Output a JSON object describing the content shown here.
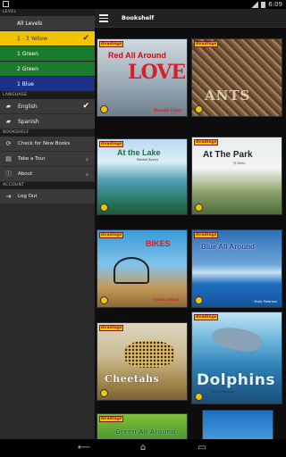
{
  "status_bar": {
    "time": "6:09"
  },
  "drawer": {
    "level_header": "LEVEL",
    "levels": [
      {
        "label": "All Levels",
        "color": "#3a3a3a"
      },
      {
        "label": "1 - 3 Yellow",
        "color": "#f2c400",
        "selected": true
      },
      {
        "label": "1 Green",
        "color": "#1a7a2e"
      },
      {
        "label": "2 Green",
        "color": "#1a7a2e"
      },
      {
        "label": "1 Blue",
        "color": "#1e2f88"
      }
    ],
    "language_header": "LANGUAGE",
    "languages": [
      {
        "label": "English",
        "selected": true
      },
      {
        "label": "Spanish",
        "selected": false
      }
    ],
    "bookshelf_header": "BOOKSHELF",
    "bookshelf_items": [
      {
        "label": "Check for New Books"
      },
      {
        "label": "Take a Tour"
      },
      {
        "label": "About"
      }
    ],
    "account_header": "ACCOUNT",
    "account_items": [
      {
        "label": "Log Out"
      }
    ]
  },
  "action_bar": {
    "title": "Bookshelf"
  },
  "books": {
    "brand": "Readings",
    "b1": {
      "title": "Red All Around",
      "art_text": "LOVE",
      "author": "Rhonda Flynn"
    },
    "b2": {
      "title": "ANTS"
    },
    "b3": {
      "title": "At the Lake",
      "author": "Robbie Byerly"
    },
    "b4": {
      "title": "At The Park",
      "author": "PJ Dietz"
    },
    "b5": {
      "title": "BIKES",
      "author": "TRAVIS TAYLOR"
    },
    "b6": {
      "title": "Blue All Around",
      "author": "Molly Peterson"
    },
    "b7": {
      "title": "Cheetahs"
    },
    "b8": {
      "title": "Dolphins",
      "author": "Molly Peterson"
    },
    "b9": {
      "title": "Green All Around"
    }
  },
  "colors": {
    "accent_yellow": "#f2c400",
    "drawer_bg": "#2a2a2a"
  }
}
